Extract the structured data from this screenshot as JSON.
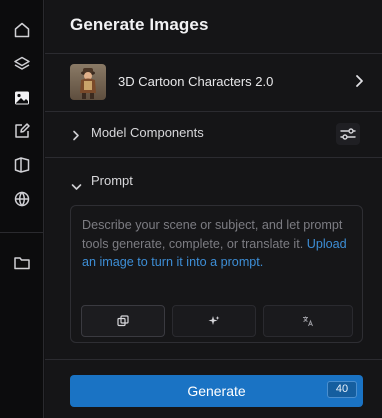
{
  "sidebar": {
    "icons": [
      "home-icon",
      "layers-icon",
      "image-icon",
      "edit-icon",
      "cube-icon",
      "globe-icon",
      "folder-icon"
    ]
  },
  "panel": {
    "title": "Generate Images",
    "model": {
      "name": "3D Cartoon Characters 2.0",
      "thumbnail": "character-thumbnail"
    },
    "model_components_label": "Model Components",
    "prompt_section_label": "Prompt",
    "prompt": {
      "placeholder_text": "Describe your scene or subject, and let prompt tools generate, complete, or translate it.",
      "upload_link": "Upload an image to turn it into a prompt."
    },
    "prompt_tools": [
      "copy-icon",
      "sparkle-icon",
      "translate-icon"
    ],
    "generate": {
      "label": "Generate",
      "cost": "40"
    }
  },
  "colors": {
    "accent": "#1a73c4",
    "link": "#3d8ed6",
    "background": "#151517"
  }
}
